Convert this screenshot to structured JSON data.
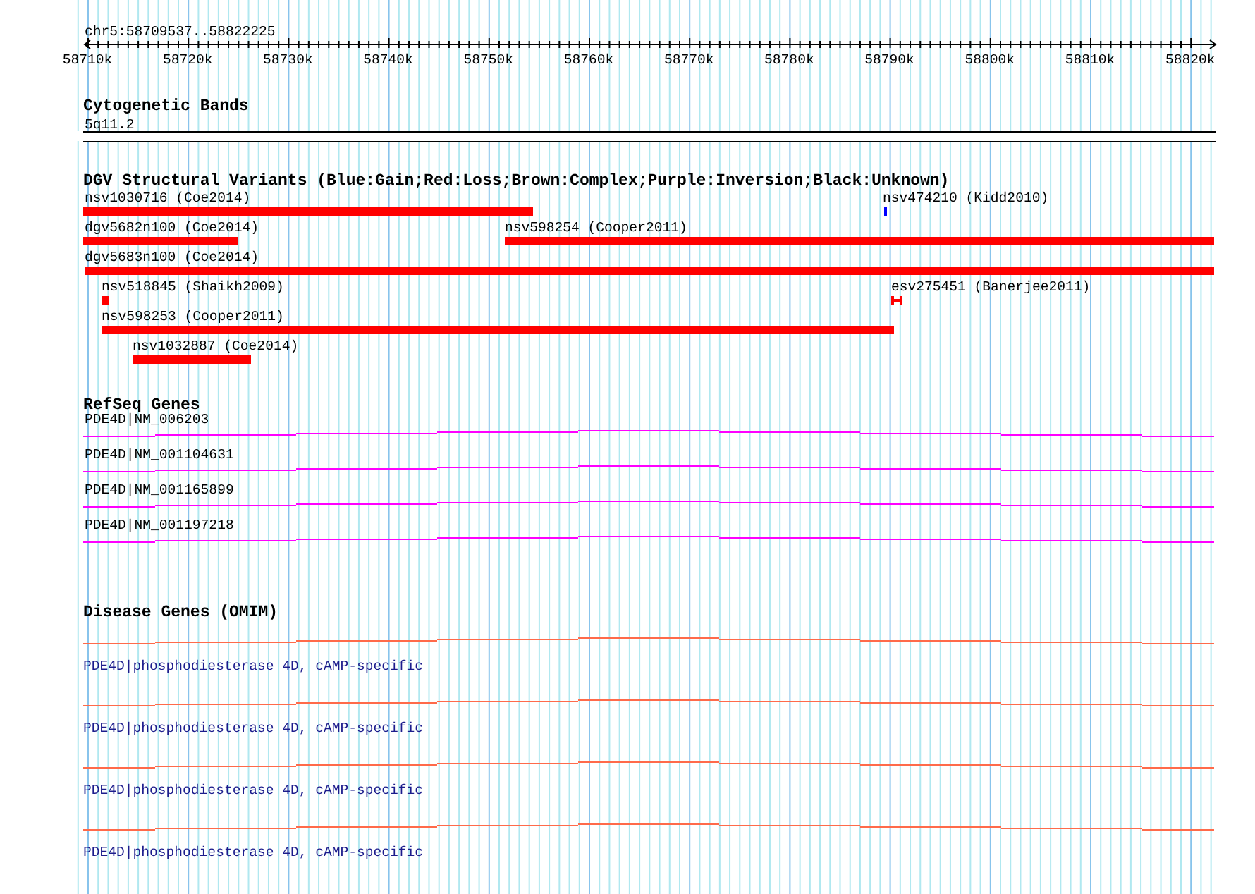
{
  "region": "chr5:58709537..58822225",
  "ruler": {
    "ticks": [
      "58710k",
      "58720k",
      "58730k",
      "58740k",
      "58750k",
      "58760k",
      "58770k",
      "58780k",
      "58790k",
      "58800k",
      "58810k",
      "58820k"
    ]
  },
  "tracks": [
    {
      "kind": "bands",
      "title": "Cytogenetic Bands",
      "items": [
        {
          "label": "5q11.2"
        }
      ]
    },
    {
      "kind": "variants",
      "title": "DGV Structural Variants (Blue:Gain;Red:Loss;Brown:Complex;Purple:Inversion;Black:Unknown)",
      "items": [
        {
          "label": "nsv1030716 (Coe2014)",
          "kind": "bar",
          "color": "#ff0000"
        },
        {
          "label": "nsv474210 (Kidd2010)",
          "kind": "bar",
          "color": "#0000ff"
        },
        {
          "label": "dgv5682n100 (Coe2014)",
          "kind": "bar",
          "color": "#ff0000"
        },
        {
          "label": "nsv598254 (Cooper2011)",
          "kind": "bar",
          "color": "#ff0000"
        },
        {
          "label": "dgv5683n100 (Coe2014)",
          "kind": "bar",
          "color": "#ff0000"
        },
        {
          "label": "nsv518845 (Shaikh2009)",
          "kind": "bar",
          "color": "#ff0000"
        },
        {
          "label": "esv275451 (Banerjee2011)",
          "kind": "bracket",
          "color": "#ff0000"
        },
        {
          "label": "nsv598253 (Cooper2011)",
          "kind": "bar",
          "color": "#ff0000"
        },
        {
          "label": "nsv1032887 (Coe2014)",
          "kind": "bar",
          "color": "#ff0000"
        }
      ]
    },
    {
      "kind": "genes",
      "title": "RefSeq Genes",
      "items": [
        {
          "label": "PDE4D|NM_006203"
        },
        {
          "label": "PDE4D|NM_001104631"
        },
        {
          "label": "PDE4D|NM_001165899"
        },
        {
          "label": "PDE4D|NM_001197218"
        }
      ]
    },
    {
      "kind": "disease",
      "title": "Disease Genes (OMIM)",
      "items": [
        {
          "label": "PDE4D|phosphodiesterase 4D, cAMP-specific"
        },
        {
          "label": "PDE4D|phosphodiesterase 4D, cAMP-specific"
        },
        {
          "label": "PDE4D|phosphodiesterase 4D, cAMP-specific"
        },
        {
          "label": "PDE4D|phosphodiesterase 4D, cAMP-specific"
        }
      ]
    }
  ]
}
